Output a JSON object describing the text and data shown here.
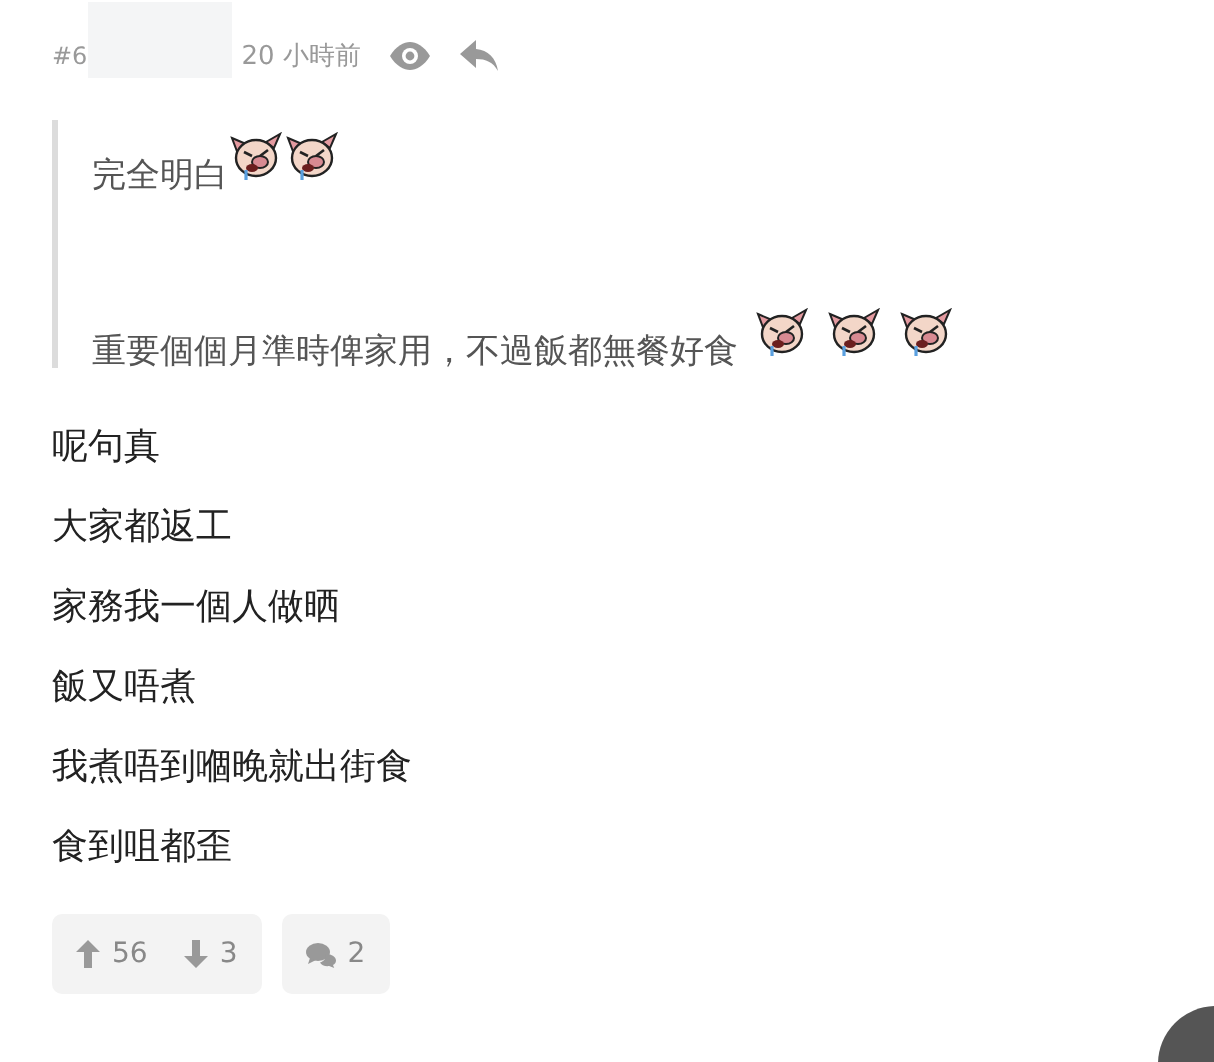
{
  "post": {
    "number": "#6",
    "time": "20 小時前"
  },
  "quote": {
    "paragraphs": [
      {
        "text": "完全明白",
        "emojis": [
          {
            "kind": "crying-pig"
          },
          {
            "kind": "crying-pig"
          }
        ]
      },
      {
        "text": "重要個個月準時俾家用，不過飯都無餐好食",
        "emojis": [
          {
            "kind": "crying-pig"
          },
          {
            "kind": "crying-pig"
          },
          {
            "kind": "crying-pig"
          }
        ]
      }
    ]
  },
  "body": [
    "呢句真",
    "大家都返工",
    "家務我一個人做晒",
    "飯又唔煮",
    "我煮唔到嗰晚就出街食",
    "食到咀都歪"
  ],
  "actions": {
    "upvotes": "56",
    "downvotes": "3",
    "replies": "2"
  }
}
